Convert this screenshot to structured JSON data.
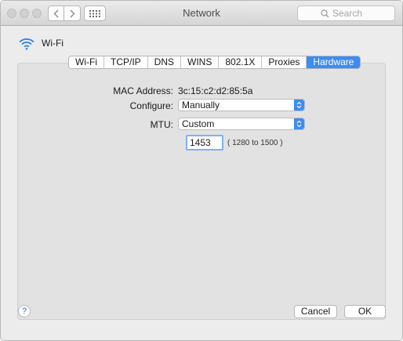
{
  "window": {
    "title": "Network"
  },
  "toolbar": {
    "back_icon": "chevron-left-icon",
    "forward_icon": "chevron-right-icon",
    "grid_icon": "grid-icon",
    "search_placeholder": "Search"
  },
  "header": {
    "service_label": "Wi-Fi",
    "icon": "wifi-icon"
  },
  "tabs": [
    {
      "label": "Wi-Fi",
      "active": false
    },
    {
      "label": "TCP/IP",
      "active": false
    },
    {
      "label": "DNS",
      "active": false
    },
    {
      "label": "WINS",
      "active": false
    },
    {
      "label": "802.1X",
      "active": false
    },
    {
      "label": "Proxies",
      "active": false
    },
    {
      "label": "Hardware",
      "active": true
    }
  ],
  "hardware": {
    "mac_label": "MAC Address:",
    "mac_value": "3c:15:c2:d2:85:5a",
    "configure_label": "Configure:",
    "configure_value": "Manually",
    "mtu_label": "MTU:",
    "mtu_value": "Custom",
    "mtu_custom_value": "1453",
    "mtu_range": "( 1280 to 1500 )"
  },
  "footer": {
    "help_label": "?",
    "cancel_label": "Cancel",
    "ok_label": "OK"
  },
  "colors": {
    "accent": "#3c8cf4",
    "window_bg": "#ececec",
    "panel_bg": "#e2e2e2"
  }
}
